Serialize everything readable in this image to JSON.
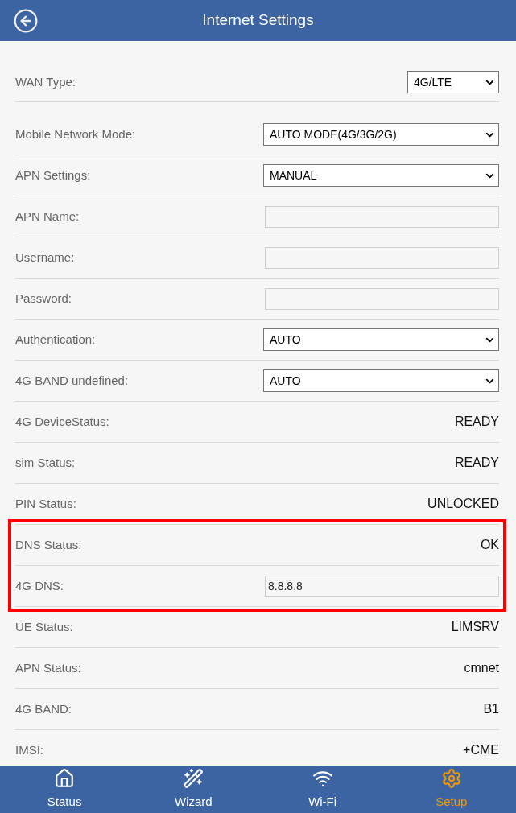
{
  "header": {
    "title": "Internet Settings"
  },
  "rows": [
    {
      "label": "WAN Type:",
      "kind": "shortselect",
      "value": "4G/LTE",
      "highlighted": false
    },
    {
      "label": "Mobile Network Mode:",
      "kind": "select",
      "value": "AUTO MODE(4G/3G/2G)",
      "highlighted": false
    },
    {
      "label": "APN Settings:",
      "kind": "select",
      "value": "MANUAL",
      "highlighted": false
    },
    {
      "label": "APN Name:",
      "kind": "input",
      "highlighted": false
    },
    {
      "label": "Username:",
      "kind": "input",
      "highlighted": false
    },
    {
      "label": "Password:",
      "kind": "input",
      "highlighted": false
    },
    {
      "label": "Authentication:",
      "kind": "select",
      "value": "AUTO",
      "highlighted": false
    },
    {
      "label": "4G BAND undefined:",
      "kind": "select",
      "value": "AUTO",
      "highlighted": false
    },
    {
      "label": "4G DeviceStatus:",
      "kind": "text",
      "value": "READY",
      "highlighted": false
    },
    {
      "label": "sim Status:",
      "kind": "text",
      "value": "READY",
      "highlighted": false
    },
    {
      "label": "PIN Status:",
      "kind": "text",
      "value": "UNLOCKED",
      "highlighted": false
    },
    {
      "label": "DNS Status:",
      "kind": "text",
      "value": "OK",
      "highlighted": true
    },
    {
      "label": "4G DNS:",
      "kind": "input",
      "value": "8.8.8.8",
      "highlighted": true
    },
    {
      "label": "UE Status:",
      "kind": "text",
      "value": "LIMSRV",
      "highlighted": false
    },
    {
      "label": "APN Status:",
      "kind": "text",
      "value": "cmnet",
      "highlighted": false
    },
    {
      "label": "4G BAND:",
      "kind": "text",
      "value": "B1",
      "highlighted": false
    },
    {
      "label": "IMSI:",
      "kind": "text",
      "value": "+CME",
      "highlighted": false
    }
  ],
  "nav": [
    {
      "label": "Status",
      "selected": false
    },
    {
      "label": "Wizard",
      "selected": false
    },
    {
      "label": "Wi-Fi",
      "selected": false
    },
    {
      "label": "Setup",
      "selected": true
    }
  ]
}
